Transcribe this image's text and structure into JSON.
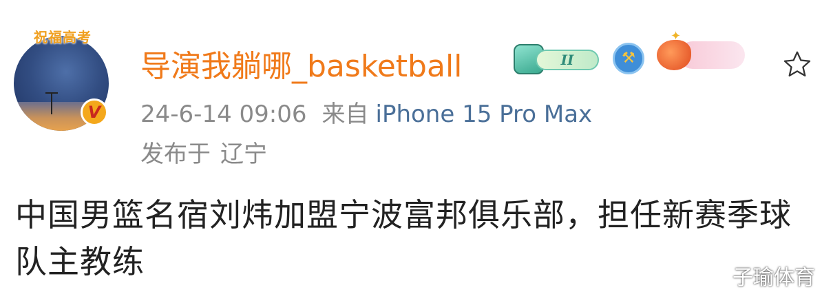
{
  "profile": {
    "avatar_caption": "祝福高考",
    "verified_badge_letter": "V",
    "username": "导演我躺哪_basketball",
    "level_badge_text": "II"
  },
  "meta": {
    "time": "24-6-14 09:06",
    "source_prefix": "来自",
    "device": "iPhone 15 Pro Max",
    "location_prefix": "发布于",
    "location": "辽宁"
  },
  "post": {
    "text": "中国男篮名宿刘炜加盟宁波富邦俱乐部，担任新赛季球队主教练"
  },
  "watermark": "子瑜体育",
  "icons": {
    "favorite": "star-outline-icon",
    "verified": "verified-v-icon",
    "shield": "shield-hammer-icon",
    "fish": "fish-badge-icon"
  },
  "colors": {
    "username": "#f07a1a",
    "device_link": "#4a6f98",
    "meta_text": "#8a8a8a",
    "body_text": "#222222"
  }
}
